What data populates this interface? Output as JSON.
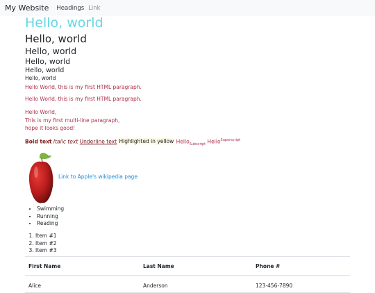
{
  "navbar": {
    "brand": "My Website",
    "links": [
      "Headings",
      "Link"
    ]
  },
  "headings": {
    "h1": "Hello, world",
    "h2": "Hello, world",
    "h3": "Hello, world",
    "h4": "Hello, world",
    "h5": "Hello, world",
    "h6": "Hello, world"
  },
  "paragraphs": {
    "p1": "Hello World, this is my first HTML paragraph.",
    "p2": "Hello World, this is my first HTML paragraph.",
    "p3_lines": [
      "Hello World,",
      "This is my first multi-line paragraph,",
      "hope it looks good!"
    ]
  },
  "formatting": {
    "bold": "Bold text",
    "italic": "Italic text",
    "underline": "Underline text",
    "highlight": "Highlighted in yellow",
    "hello_sub": "Hello",
    "subscript": "Subscript",
    "hello_sup": "Hello",
    "superscript": "Superscript"
  },
  "apple": {
    "link_text": "Link to Apple's wikipedia page",
    "colors": {
      "fruit": "#b71c1c",
      "leaf": "#7cb342"
    }
  },
  "unordered_list": [
    "Swimming",
    "Running",
    "Reading"
  ],
  "ordered_list": [
    "Item #1",
    "Item #2",
    "Item #3"
  ],
  "table": {
    "headers": [
      "First Name",
      "Last Name",
      "Phone #"
    ],
    "rows": [
      [
        "Alice",
        "Anderson",
        "123-456-7890"
      ]
    ]
  },
  "colors": {
    "h1": "#63d7e3",
    "paragraph": "#b0304e",
    "link": "#1a8bd9",
    "highlight_bg": "#fcf8e3",
    "navbar_bg": "#f8f9fa"
  }
}
